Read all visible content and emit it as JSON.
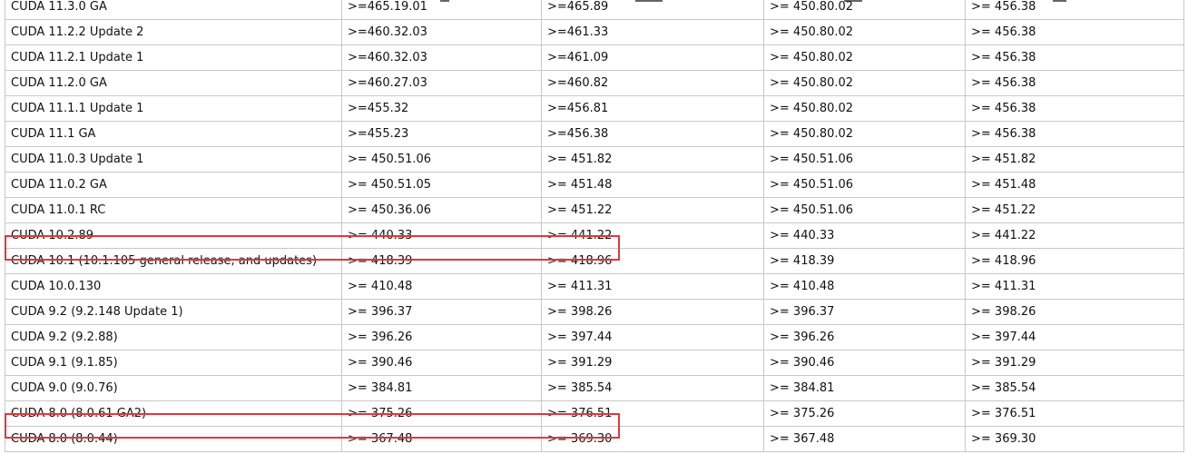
{
  "table": {
    "rows": [
      [
        "CUDA 11.3.0 GA",
        ">=465.19.01",
        ">=465.89",
        ">= 450.80.02",
        ">= 456.38"
      ],
      [
        "CUDA 11.2.2 Update 2",
        ">=460.32.03",
        ">=461.33",
        ">= 450.80.02",
        ">= 456.38"
      ],
      [
        "CUDA 11.2.1 Update 1",
        ">=460.32.03",
        ">=461.09",
        ">= 450.80.02",
        ">= 456.38"
      ],
      [
        "CUDA 11.2.0 GA",
        ">=460.27.03",
        ">=460.82",
        ">= 450.80.02",
        ">= 456.38"
      ],
      [
        "CUDA 11.1.1 Update 1",
        ">=455.32",
        ">=456.81",
        ">= 450.80.02",
        ">= 456.38"
      ],
      [
        "CUDA 11.1 GA",
        ">=455.23",
        ">=456.38",
        ">= 450.80.02",
        ">= 456.38"
      ],
      [
        "CUDA 11.0.3 Update 1",
        ">= 450.51.06",
        ">= 451.82",
        ">= 450.51.06",
        ">= 451.82"
      ],
      [
        "CUDA 11.0.2 GA",
        ">= 450.51.05",
        ">= 451.48",
        ">= 450.51.06",
        ">= 451.48"
      ],
      [
        "CUDA 11.0.1 RC",
        ">= 450.36.06",
        ">= 451.22",
        ">= 450.51.06",
        ">= 451.22"
      ],
      [
        "CUDA 10.2.89",
        ">= 440.33",
        ">= 441.22",
        ">= 440.33",
        ">= 441.22"
      ],
      [
        "CUDA 10.1 (10.1.105 general release, and updates)",
        ">= 418.39",
        ">= 418.96",
        ">= 418.39",
        ">= 418.96"
      ],
      [
        "CUDA 10.0.130",
        ">= 410.48",
        ">= 411.31",
        ">= 410.48",
        ">= 411.31"
      ],
      [
        "CUDA 9.2 (9.2.148 Update 1)",
        ">= 396.37",
        ">= 398.26",
        ">= 396.37",
        ">= 398.26"
      ],
      [
        "CUDA 9.2 (9.2.88)",
        ">= 396.26",
        ">= 397.44",
        ">= 396.26",
        ">= 397.44"
      ],
      [
        "CUDA 9.1 (9.1.85)",
        ">= 390.46",
        ">= 391.29",
        ">= 390.46",
        ">= 391.29"
      ],
      [
        "CUDA 9.0 (9.0.76)",
        ">= 384.81",
        ">= 385.54",
        ">= 384.81",
        ">= 385.54"
      ],
      [
        "CUDA 8.0 (8.0.61 GA2)",
        ">= 375.26",
        ">= 376.51",
        ">= 375.26",
        ">= 376.51"
      ],
      [
        "CUDA 8.0 (8.0.44)",
        ">= 367.48",
        ">= 369.30",
        ">= 367.48",
        ">= 369.30"
      ]
    ],
    "highlighted_rows": [
      "CUDA 10.2.89",
      "CUDA 8.0 (8.0.61 GA2)"
    ]
  },
  "colors": {
    "highlight": "#e0383b",
    "grid": "#c8c8c8",
    "text": "#111111"
  }
}
